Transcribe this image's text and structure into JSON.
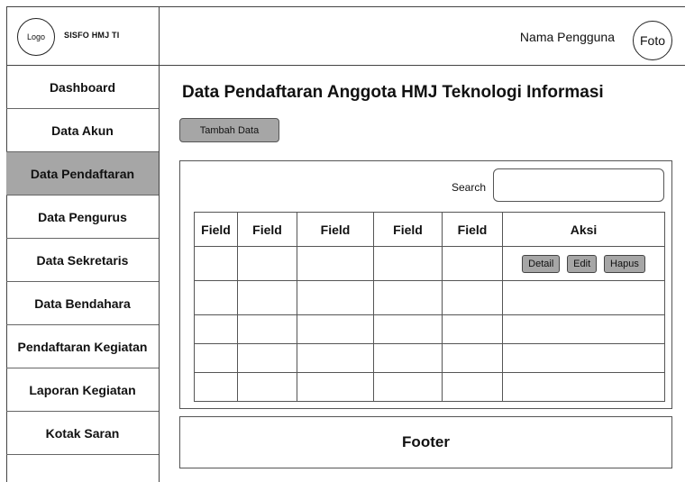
{
  "brand": {
    "logo_text": "Logo",
    "app_name": "SISFO HMJ TI"
  },
  "header": {
    "user_name": "Nama Pengguna",
    "avatar_text": "Foto"
  },
  "sidebar": {
    "items": [
      {
        "label": "Dashboard"
      },
      {
        "label": "Data Akun"
      },
      {
        "label": "Data Pendaftaran"
      },
      {
        "label": "Data Pengurus"
      },
      {
        "label": "Data Sekretaris"
      },
      {
        "label": "Data Bendahara"
      },
      {
        "label": "Pendaftaran Kegiatan"
      },
      {
        "label": "Laporan Kegiatan"
      },
      {
        "label": "Kotak Saran"
      }
    ],
    "active_index": 2
  },
  "main": {
    "title": "Data Pendaftaran Anggota HMJ Teknologi Informasi",
    "add_button": "Tambah Data",
    "search_label": "Search",
    "search_value": "",
    "table": {
      "headers": [
        "Field",
        "Field",
        "Field",
        "Field",
        "Field",
        "Aksi"
      ],
      "actions": {
        "detail": "Detail",
        "edit": "Edit",
        "delete": "Hapus"
      }
    }
  },
  "footer": {
    "label": "Footer"
  },
  "colors": {
    "active_bg": "#a6a6a6",
    "button_bg": "#a6a6a6",
    "border": "#555555"
  }
}
